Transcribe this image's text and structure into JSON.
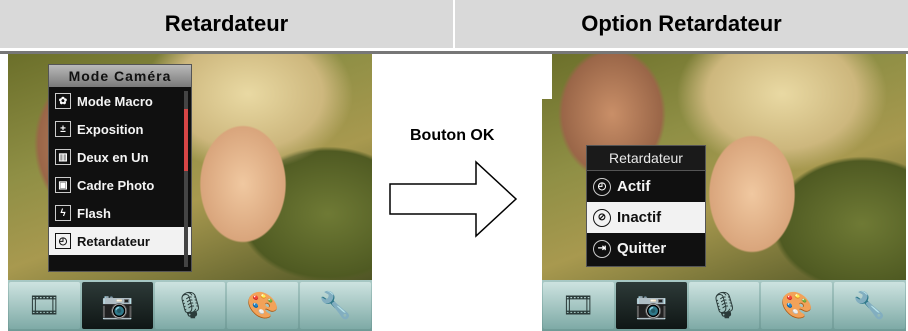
{
  "headers": {
    "left": "Retardateur",
    "right": "Option Retardateur"
  },
  "arrow_label": "Bouton OK",
  "left_screen": {
    "menu_title": "Mode Caméra",
    "items": [
      {
        "label": "Mode Macro",
        "icon": "macro-icon",
        "selected": false
      },
      {
        "label": "Exposition",
        "icon": "exposure-icon",
        "selected": false
      },
      {
        "label": "Deux en Un",
        "icon": "two-in-one-icon",
        "selected": false
      },
      {
        "label": "Cadre Photo",
        "icon": "photo-frame-icon",
        "selected": false
      },
      {
        "label": "Flash",
        "icon": "flash-icon",
        "selected": false
      },
      {
        "label": "Retardateur",
        "icon": "self-timer-icon",
        "selected": true
      }
    ]
  },
  "right_screen": {
    "menu_title": "Retardateur",
    "items": [
      {
        "label": "Actif",
        "icon": "timer-on-icon",
        "selected": false
      },
      {
        "label": "Inactif",
        "icon": "timer-off-icon",
        "selected": true
      },
      {
        "label": "Quitter",
        "icon": "exit-icon",
        "selected": false
      }
    ]
  },
  "bottom_bar": [
    {
      "name": "video-mode-icon",
      "active": false
    },
    {
      "name": "camera-mode-icon",
      "active": true
    },
    {
      "name": "voice-mode-icon",
      "active": false
    },
    {
      "name": "playback-mode-icon",
      "active": false
    },
    {
      "name": "settings-mode-icon",
      "active": false
    }
  ],
  "colors": {
    "header_bg": "#d9d9d9",
    "menu_bg": "#101010",
    "selected_bg": "#f2f2f2",
    "scroll_thumb": "#d64545",
    "bar_bg": "#8fb6b2"
  }
}
